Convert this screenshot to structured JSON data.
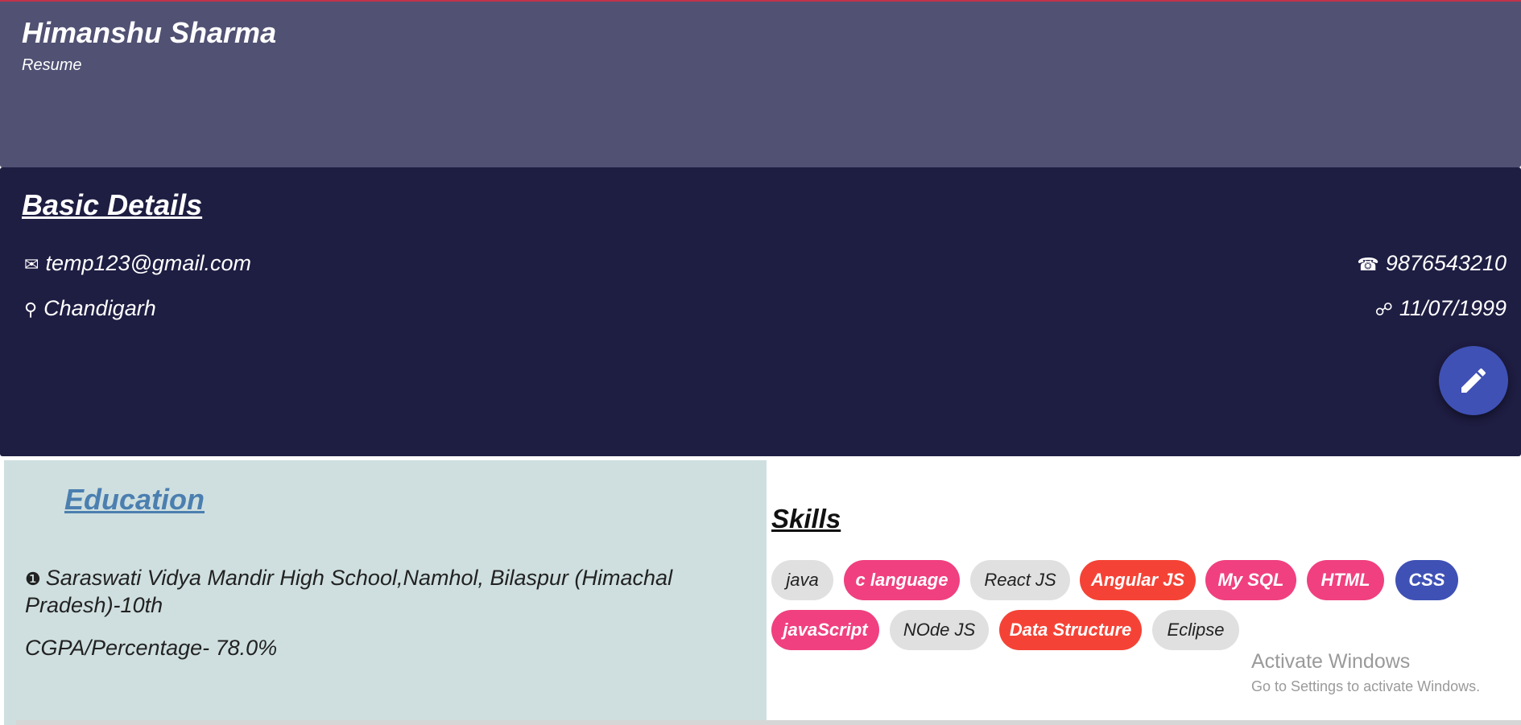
{
  "header": {
    "name": "Himanshu Sharma",
    "subtitle": "Resume"
  },
  "basic_details": {
    "title": "Basic Details",
    "email": "temp123@gmail.com",
    "phone": "9876543210",
    "location": "Chandigarh",
    "dob": "11/07/1999",
    "icons": {
      "email": "mail-icon",
      "phone": "phone-icon",
      "location": "location-pin-icon",
      "dob": "link-icon",
      "edit": "pencil-icon"
    }
  },
  "education": {
    "title": "Education",
    "school": "Saraswati Vidya Mandir High School,Namhol, Bilaspur (Himachal Pradesh)-10th",
    "cgpa": "CGPA/Percentage- 78.0%"
  },
  "skills": {
    "title": "Skills",
    "items": [
      {
        "label": "java",
        "color": "#e0e0e0"
      },
      {
        "label": "c language",
        "color": "#f0407f"
      },
      {
        "label": "React JS",
        "color": "#e0e0e0"
      },
      {
        "label": "Angular JS",
        "color": "#f44336"
      },
      {
        "label": "My SQL",
        "color": "#f0407f"
      },
      {
        "label": "HTML",
        "color": "#f0407f"
      },
      {
        "label": "CSS",
        "color": "#3f51b5"
      },
      {
        "label": "javaScript",
        "color": "#f0407f"
      },
      {
        "label": "NOde JS",
        "color": "#e0e0e0"
      },
      {
        "label": "Data Structure",
        "color": "#f44336"
      },
      {
        "label": "Eclipse",
        "color": "#e0e0e0"
      }
    ]
  },
  "watermark": {
    "line1": "Activate Windows",
    "line2": "Go to Settings to activate Windows."
  },
  "colors": {
    "header_bg": "#515174",
    "details_bg": "#1e1d42",
    "education_bg": "#cfdfdf",
    "fab": "#3f51b5"
  }
}
